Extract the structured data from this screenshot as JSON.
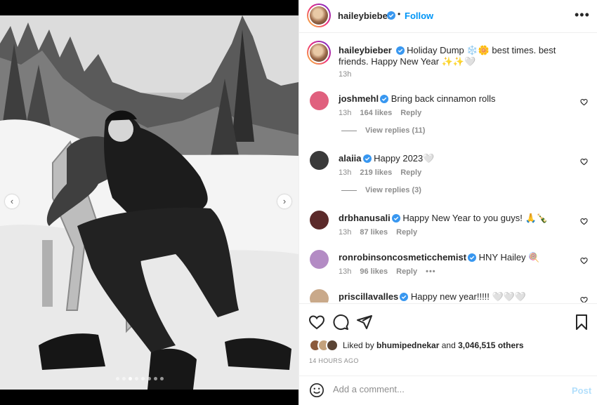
{
  "post": {
    "author": "haileybieber",
    "follow_label": "Follow",
    "separator": "•",
    "more_label": "•••",
    "caption": "Holiday Dump ❄️🌼 best times. best friends. Happy New Year ✨✨🤍",
    "caption_time": "13h"
  },
  "media": {
    "image_description": "black and white photo of two people hugging on a wooden chair in snow with pine trees",
    "prev_label": "‹",
    "next_label": "›",
    "slide_count": 8,
    "active_slide": 2
  },
  "comments": [
    {
      "user": "joshmehl",
      "text": "Bring back cinnamon rolls",
      "time": "13h",
      "likes": "164 likes",
      "reply": "Reply",
      "replies_label": "View replies (11)",
      "avatar_color": "#e0607e"
    },
    {
      "user": "alaiia",
      "text": "Happy 2023🤍",
      "time": "13h",
      "likes": "219 likes",
      "reply": "Reply",
      "replies_label": "View replies (3)",
      "avatar_color": "#3a3a3a"
    },
    {
      "user": "drbhanusali",
      "text": "Happy New Year to you guys! 🙏🍾",
      "time": "13h",
      "likes": "87 likes",
      "reply": "Reply",
      "avatar_color": "#5b2a2a"
    },
    {
      "user": "ronrobinsoncosmeticchemist",
      "text": "HNY Hailey 🍭",
      "time": "13h",
      "likes": "96 likes",
      "reply": "Reply",
      "more": "•••",
      "avatar_color": "#b38bc4"
    },
    {
      "user": "priscillavalles",
      "text": "Happy new year!!!!! 🤍🤍🤍",
      "avatar_color": "#c9a98a"
    }
  ],
  "likes": {
    "prefix": "Liked by ",
    "user": "bhumipednekar",
    "middle": " and ",
    "count": "3,046,515 others"
  },
  "timestamp": "14 HOURS AGO",
  "add_comment": {
    "placeholder": "Add a comment...",
    "post_label": "Post"
  },
  "colors": {
    "accent": "#0095f6",
    "verified": "#3897f0",
    "post_disabled": "#b2dffc"
  },
  "icons": [
    "heart-icon",
    "comment-icon",
    "share-icon",
    "bookmark-icon",
    "emoji-icon",
    "verified-icon"
  ]
}
